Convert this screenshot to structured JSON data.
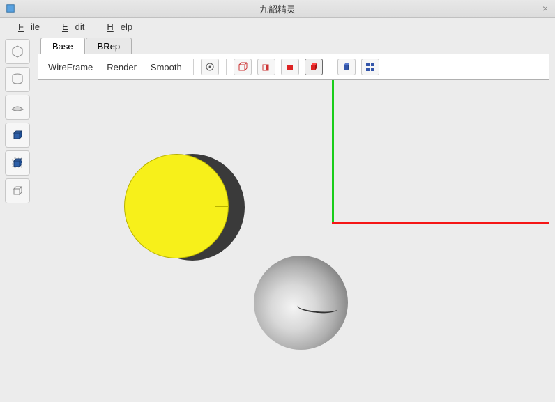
{
  "window": {
    "title": "九韶精灵"
  },
  "menu": {
    "file": "File",
    "edit": "Edit",
    "help": "Help"
  },
  "tabs": [
    {
      "label": "Base",
      "active": true
    },
    {
      "label": "BRep",
      "active": false
    }
  ],
  "modes": {
    "wireframe": "WireFrame",
    "render": "Render",
    "smooth": "Smooth"
  },
  "sidebar_tools": [
    "sketch",
    "revolve",
    "plane",
    "box",
    "box-outline",
    "sphere-outline"
  ],
  "view_tools": [
    "zoom",
    "wire-cube",
    "halfwire",
    "solid-cube",
    "shaded-cube",
    "iso-cube",
    "multi-cube"
  ]
}
